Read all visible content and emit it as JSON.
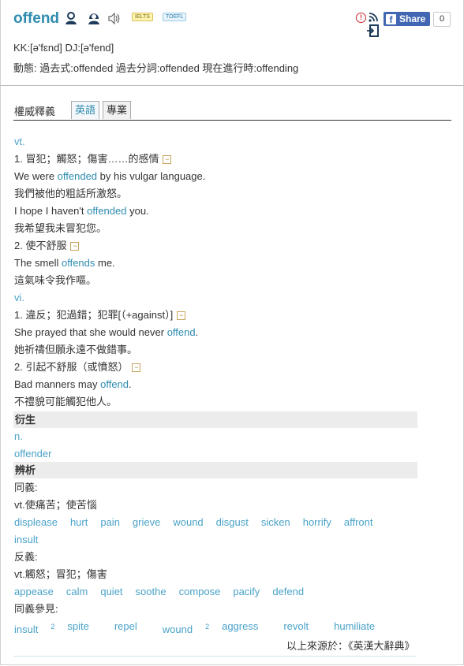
{
  "header": {
    "word": "offend",
    "badges": {
      "ielts": "IELTS",
      "toefl": "TOEFL"
    },
    "phonetic": "KK:[ə'fɛnd] DJ:[ə'fend]",
    "forms": "動態: 過去式:offended  過去分詞:offended  現在進行時:offending",
    "share_label": "Share",
    "share_count": "0",
    "icons": [
      "male-speaker-icon",
      "female-speaker-icon",
      "speaker-icon",
      "report-icon",
      "rss-icon",
      "add-to-wordbook-icon",
      "facebook-icon"
    ]
  },
  "tabs": {
    "title": "權威釋義",
    "items": [
      "英語",
      "專業"
    ]
  },
  "definitions": {
    "vt_label": "vt.",
    "def1": "1. 冒犯；觸怒；傷害……的感情",
    "ex1a_pre": "We were ",
    "ex1a_word": "offended",
    "ex1a_post": " by his vulgar language.",
    "ex1a_zh": "我們被他的粗話所激怒。",
    "ex1b_pre": "I hope I haven't ",
    "ex1b_word": "offended",
    "ex1b_post": " you.",
    "ex1b_zh": "我希望我未冒犯您。",
    "def2": "2. 使不舒服",
    "ex2_pre": "The smell ",
    "ex2_word": "offends",
    "ex2_post": " me.",
    "ex2_zh": "這氣味令我作嘔。",
    "vi_label": "vi.",
    "def3": "1. 違反；犯過錯；犯罪[（+against）]",
    "ex3_pre": "She prayed that she would never ",
    "ex3_word": "offend",
    "ex3_post": ".",
    "ex3_zh": "她祈禱但願永遠不做錯事。",
    "def4": "2. 引起不舒服（或憤怒）",
    "ex4_pre": "Bad manners may ",
    "ex4_word": "offend",
    "ex4_post": ".",
    "ex4_zh": "不禮貌可能觸犯他人。",
    "collapse_glyph": "−"
  },
  "derivatives": {
    "heading": "衍生",
    "pos": "n.",
    "word": "offender"
  },
  "analysis": {
    "heading": "辨析",
    "syn_label": "同義:",
    "syn_sense": "vt.使痛苦；使苦惱",
    "syn_words": [
      "displease",
      "hurt",
      "pain",
      "grieve",
      "wound",
      "disgust",
      "sicken",
      "horrify",
      "affront"
    ],
    "syn_words2": [
      "insult"
    ],
    "ant_label": "反義:",
    "ant_sense": "vt.觸怒；冒犯；傷害",
    "ant_words": [
      "appease",
      "calm",
      "quiet",
      "soothe",
      "compose",
      "pacify",
      "defend"
    ],
    "see_label": "同義參見:",
    "see_words": [
      {
        "w": "insult",
        "sup": "2"
      },
      {
        "w": "spite",
        "sup": ""
      },
      {
        "w": "repel",
        "sup": ""
      },
      {
        "w": "wound",
        "sup": "2"
      },
      {
        "w": "aggress",
        "sup": ""
      },
      {
        "w": "revolt",
        "sup": ""
      },
      {
        "w": "humiliate",
        "sup": ""
      }
    ]
  },
  "source": "以上來源於：《英漢大辭典》",
  "colors": {
    "accent": "#2e8bb0",
    "link": "#4aa2c8",
    "band": "#ececec"
  }
}
